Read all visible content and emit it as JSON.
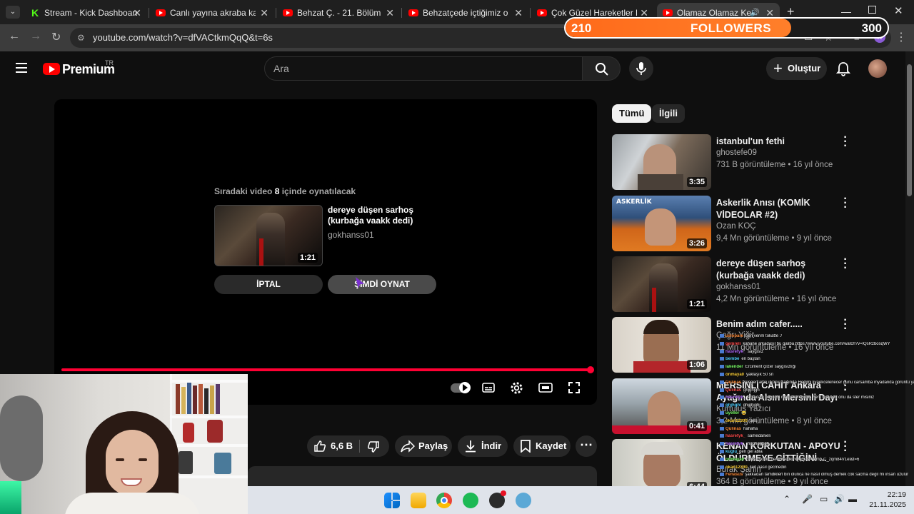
{
  "browser": {
    "tabs": [
      {
        "title": "Stream - Kick Dashboard",
        "icon": "kick-icon"
      },
      {
        "title": "Canlı yayına akraba katılm",
        "icon": "youtube-icon"
      },
      {
        "title": "Behzat Ç. - 21. Bölüm HD",
        "icon": "youtube-icon"
      },
      {
        "title": "Behzatçede içtiğimiz o bey",
        "icon": "youtube-icon"
      },
      {
        "title": "Çok Güzel Hareketler Bunla",
        "icon": "youtube-icon"
      },
      {
        "title": "Olamaz Olamaz Kenan",
        "icon": "youtube-icon",
        "active": true
      }
    ],
    "url": "youtube.com/watch?v=dfVACtkmQqQ&t=6s"
  },
  "followers_goal": {
    "current": "210",
    "label": "FOLLOWERS",
    "goal": "300",
    "progress": 0.7
  },
  "youtube": {
    "logo_text": "Premium",
    "country": "TR",
    "search_placeholder": "Ara",
    "create_label": "Oluştur"
  },
  "player": {
    "upnext_prefix": "Sıradaki video ",
    "upnext_seconds": "8",
    "upnext_suffix": " içinde oynatılacak",
    "next_title": "dereye düşen sarhoş (kurbağa vaakk dedi)",
    "next_channel": "gokhanss01",
    "next_duration": "1:21",
    "cancel_label": "İPTAL",
    "play_now_label": "ŞİMDİ OYNAT",
    "progress": 1.0
  },
  "actions": {
    "likes": "6,6 B",
    "share": "Paylaş",
    "download": "İndir",
    "save": "Kaydet"
  },
  "chips": [
    "Tümü",
    "İlgili"
  ],
  "related": [
    {
      "title": "istanbul'un fethi",
      "channel": "ghostefe09",
      "meta": "731 B görüntüleme • 16 yıl önce",
      "duration": "3:35",
      "theme": "shop"
    },
    {
      "title": "Askerlik Anısı (KOMİK VİDEOLAR #2)",
      "channel": "Ozan KOÇ",
      "meta": "9,4 Mn görüntüleme • 9 yıl önce",
      "duration": "3:26",
      "theme": "vest"
    },
    {
      "title": "dereye düşen sarhoş (kurbağa vaakk dedi)",
      "channel": "gokhanss01",
      "meta": "4,2 Mn görüntüleme • 16 yıl önce",
      "duration": "1:21",
      "theme": "night"
    },
    {
      "title": "Benim adım cafer.....",
      "channel": "Çağrı Yiğit",
      "meta": "11 Mn görüntüleme • 16 yıl önce",
      "duration": "1:06",
      "theme": "wall"
    },
    {
      "title": "MERSİNLİ CAHİT Ankara Ayağında Alsın Mersinli Dayı",
      "channel": "Kurtuluş Yazıcı",
      "meta": "3,2 Mn görüntüleme • 8 yıl önce",
      "duration": "0:41",
      "theme": "street"
    },
    {
      "title": "KENAN KORKUTAN - APOYU ÖLDÜRMEYE GİTTİĞİNİ ...",
      "channel": "Burak Şahin",
      "meta": "364 B görüntüleme • 9 yıl önce",
      "duration": "6:44",
      "theme": "old"
    }
  ],
  "chat": [
    {
      "user": "uslopare",
      "text": "ben verim tokatte :/"
    },
    {
      "user": "gemreli",
      "text": "kahane arkadaşıl bu galiba https://www.youtube.com/watch?v=lQsRzbosqWY"
    },
    {
      "user": "hasretyk_",
      "text": "saygısız"
    },
    {
      "user": "bembe",
      "text": "en baştan"
    },
    {
      "user": "lakender",
      "text": "Erciment çilzer saygısızlığı"
    },
    {
      "user": "onmaya0",
      "text": "yaklaşık 50 sn"
    },
    {
      "user": "Qulinas",
      "text": "Yengen artık ilkokul çağında Hedimi liyaekceleriecer gunu carsamba myadanda görüntü yaptınıl ayamadenöve"
    },
    {
      "user": "Qulinas",
      "text": "ghjghjgh"
    },
    {
      "user": "hasretyk_",
      "text": "arkadaşi bunu bil marcelları bizda hem mal bey onu da ster misiniz"
    },
    {
      "user": "ghjhghl",
      "text": "ghjghjghj"
    },
    {
      "user": "uyeller",
      "text": "😂"
    },
    {
      "user": "okan12300",
      "text": "uwu"
    },
    {
      "user": "Qulinas",
      "text": "hahaha"
    },
    {
      "user": "hasretyk_",
      "text": "samedanieli"
    },
    {
      "user": "hasretyk_",
      "text": "hgghgghgh"
    },
    {
      "user": "kuglu",
      "text": "geri gel abla"
    },
    {
      "user": "onmaya0",
      "text": "https://youtu.be/dfVACtkmQqQ?si=4lmb-C_zqm84V1el&t=6"
    },
    {
      "user": "okan12300",
      "text": "sen nasıl gecmedin"
    },
    {
      "user": "Fenasus",
      "text": "şakkadan tamdiklerl biri olunca ne nasıl olmuş demek cok sacma degil mi insan uzulur"
    }
  ],
  "clock": {
    "time": "22:19",
    "date": "21.11.2025"
  }
}
